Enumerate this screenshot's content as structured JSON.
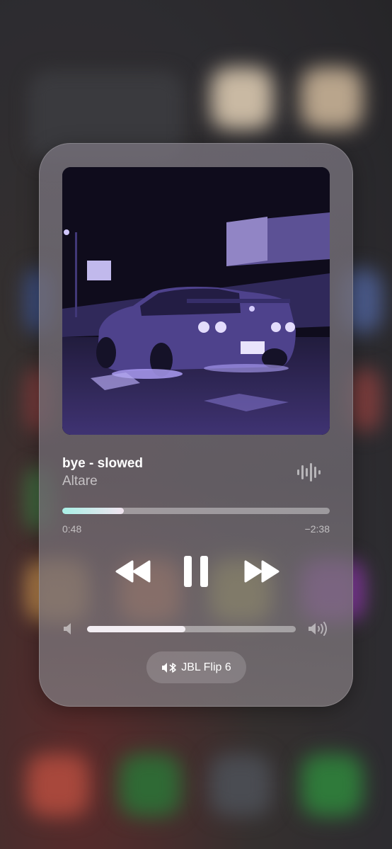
{
  "now_playing": {
    "title": "bye - slowed",
    "artist": "Altare",
    "progress_fraction": 0.23,
    "elapsed": "0:48",
    "remaining": "−2:38",
    "volume_fraction": 0.47,
    "output_device": "JBL Flip 6"
  },
  "icons": {
    "waveform": "waveform-icon",
    "rewind": "rewind-icon",
    "pause": "pause-icon",
    "fast_forward": "fast-forward-icon",
    "volume_low": "volume-low-icon",
    "volume_high": "volume-high-icon",
    "airplay_bluetooth": "bluetooth-speaker-icon"
  },
  "colors": {
    "progress_start": "#a9f0e6",
    "progress_end": "#f2e4f0",
    "art_tint": "#7b6bd6"
  }
}
